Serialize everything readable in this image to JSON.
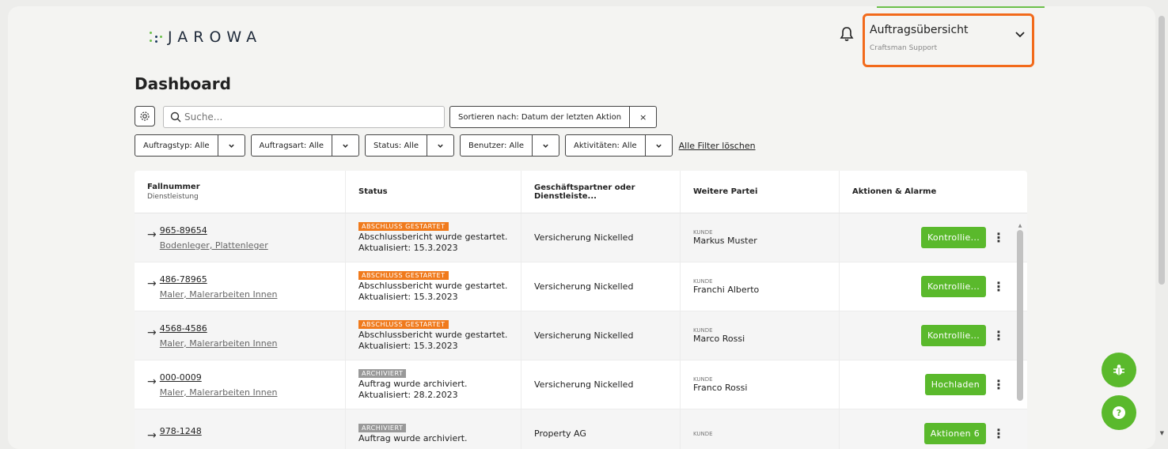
{
  "brand": {
    "logo_text": "JAROWA"
  },
  "account": {
    "title": "Auftragsübersicht",
    "subtitle": "Craftsman Support"
  },
  "page": {
    "title": "Dashboard"
  },
  "search": {
    "placeholder": "Suche..."
  },
  "sort": {
    "label": "Sortieren nach: Datum der letzten Aktion",
    "clear": "×"
  },
  "filters": [
    {
      "label": "Auftragstyp: Alle"
    },
    {
      "label": "Auftragsart: Alle"
    },
    {
      "label": "Status: Alle"
    },
    {
      "label": "Benutzer: Alle"
    },
    {
      "label": "Aktivitäten: Alle"
    }
  ],
  "clear_filters": "Alle Filter löschen",
  "table": {
    "headers": {
      "case": "Fallnummer",
      "case_sub": "Dienstleistung",
      "status": "Status",
      "partner": "Geschäftspartner oder Dienstleiste...",
      "party": "Weitere Partei",
      "actions": "Aktionen & Alarme"
    },
    "rows": [
      {
        "case": "965-89654",
        "service": "Bodenleger, Plattenleger",
        "badge": "ABSCHLUSS GESTARTET",
        "badge_color": "#f07a1c",
        "status": "Abschlussbericht wurde gestartet.",
        "updated": "Aktualisiert: 15.3.2023",
        "partner": "Versicherung Nickelled",
        "party_label": "KUNDE",
        "party_name": "Markus Muster",
        "action": "Kontrollie..."
      },
      {
        "case": "486-78965",
        "service": "Maler, Malerarbeiten Innen",
        "badge": "ABSCHLUSS GESTARTET",
        "badge_color": "#f07a1c",
        "status": "Abschlussbericht wurde gestartet.",
        "updated": "Aktualisiert: 15.3.2023",
        "partner": "Versicherung Nickelled",
        "party_label": "KUNDE",
        "party_name": "Franchi Alberto",
        "action": "Kontrollie..."
      },
      {
        "case": "4568-4586",
        "service": "Maler, Malerarbeiten Innen",
        "badge": "ABSCHLUSS GESTARTET",
        "badge_color": "#f07a1c",
        "status": "Abschlussbericht wurde gestartet.",
        "updated": "Aktualisiert: 15.3.2023",
        "partner": "Versicherung Nickelled",
        "party_label": "KUNDE",
        "party_name": "Marco Rossi",
        "action": "Kontrollie..."
      },
      {
        "case": "000-0009",
        "service": "Maler, Malerarbeiten Innen",
        "badge": "ARCHIVIERT",
        "badge_color": "#999999",
        "status": "Auftrag wurde archiviert.",
        "updated": "Aktualisiert: 28.2.2023",
        "partner": "Versicherung Nickelled",
        "party_label": "KUNDE",
        "party_name": "Franco Rossi",
        "action": "Hochladen"
      },
      {
        "case": "978-1248",
        "service": "",
        "badge": "ARCHIVIERT",
        "badge_color": "#999999",
        "status": "Auftrag wurde archiviert.",
        "updated": "",
        "partner": "Property AG",
        "party_label": "KUNDE",
        "party_name": "",
        "action": "Aktionen 6"
      }
    ]
  },
  "colors": {
    "accent": "#5ab92c",
    "highlight": "#f26a1b",
    "badge_orange": "#f07a1c"
  },
  "icons": [
    "bell-icon",
    "chevron-down-icon",
    "gear-icon",
    "search-icon",
    "arrow-right-icon",
    "kebab-icon",
    "bug-icon",
    "help-icon"
  ]
}
